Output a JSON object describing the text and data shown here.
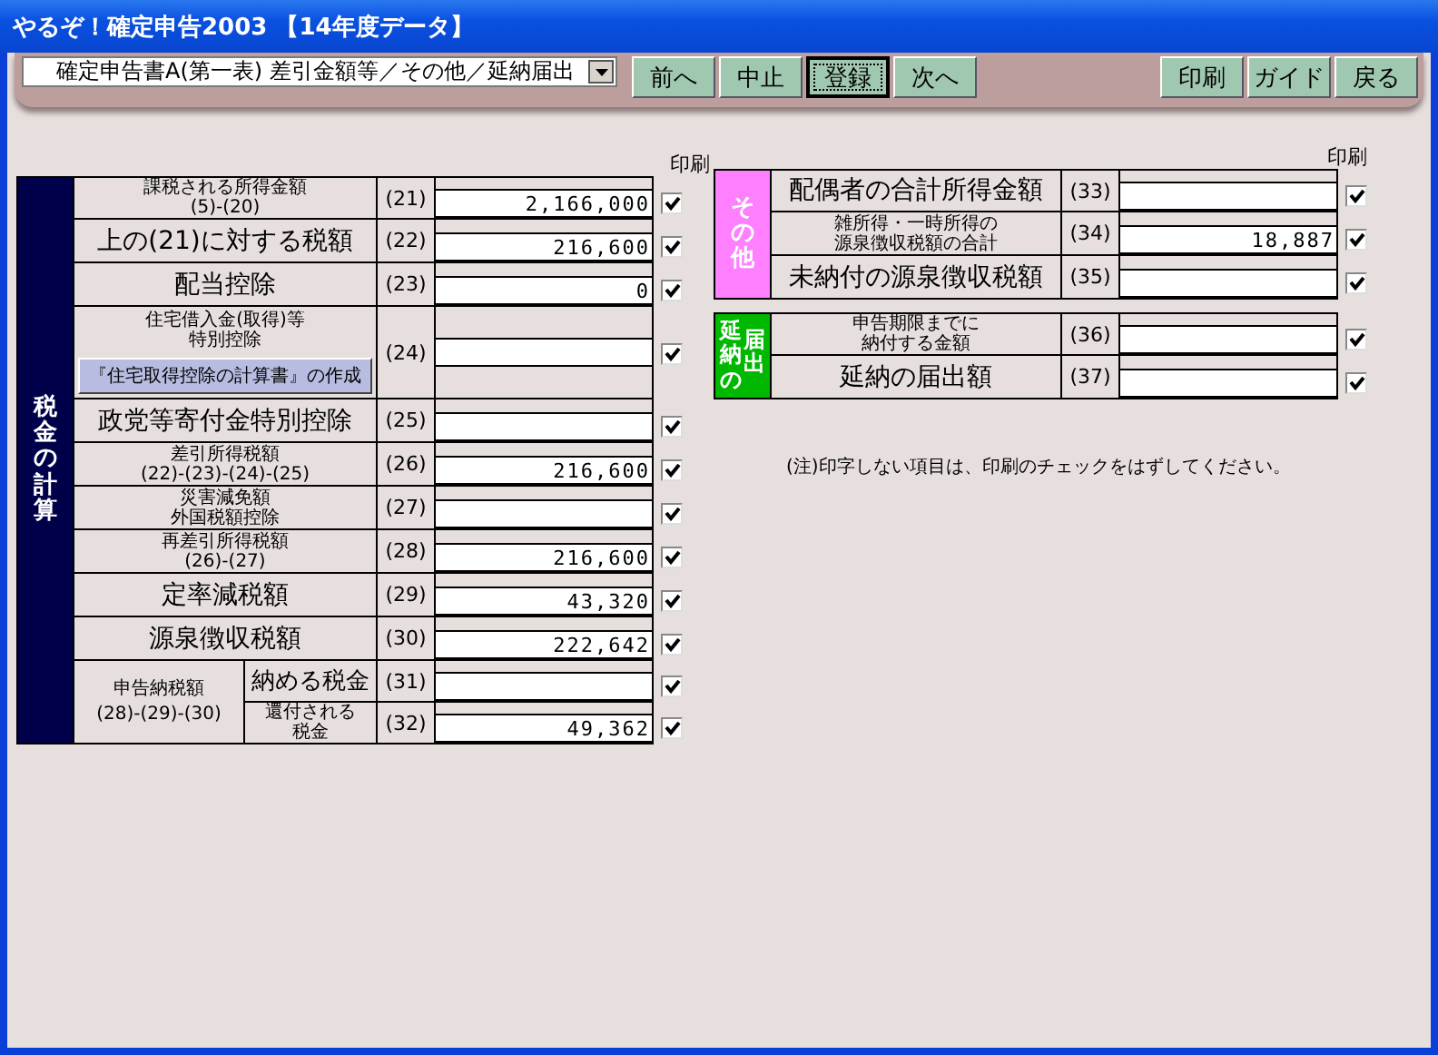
{
  "window": {
    "title": "やるぞ！確定申告2003 【14年度データ】"
  },
  "toolbar": {
    "form_select": {
      "value": "確定申告書A(第一表) 差引金額等／その他／延納届出"
    },
    "nav_buttons": [
      {
        "label": "前へ",
        "focused": false
      },
      {
        "label": "中止",
        "focused": false
      },
      {
        "label": "登録",
        "focused": true
      },
      {
        "label": "次へ",
        "focused": false
      }
    ],
    "right_buttons": [
      {
        "label": "印刷",
        "focused": false
      },
      {
        "label": "ガイド",
        "focused": false
      },
      {
        "label": "戻る",
        "focused": false
      }
    ]
  },
  "tax_section": {
    "title": "税金の計算",
    "print_header": "印刷",
    "rows": [
      {
        "kind": "field",
        "lines": [
          "課税される所得金額",
          "(5)-(20)"
        ],
        "number": "(21)",
        "value": "2,166,000",
        "checked": true
      },
      {
        "kind": "field",
        "lines": [
          "上の(21)に対する税額"
        ],
        "number": "(22)",
        "value": "216,600",
        "checked": true
      },
      {
        "kind": "field",
        "lines": [
          "配当控除"
        ],
        "number": "(23)",
        "value": "0",
        "checked": true
      },
      {
        "kind": "button",
        "lines": [
          "住宅借入金(取得)等",
          "特別控除"
        ],
        "button": "『住宅取得控除の計算書』の作成",
        "number": "(24)",
        "checked": true
      },
      {
        "kind": "field",
        "lines": [
          "政党等寄付金特別控除"
        ],
        "number": "(25)",
        "checked": true
      },
      {
        "kind": "field",
        "lines": [
          "差引所得税額",
          "(22)-(23)-(24)-(25)"
        ],
        "number": "(26)",
        "value": "216,600",
        "checked": true
      },
      {
        "kind": "field",
        "lines": [
          "災害減免額",
          "外国税額控除"
        ],
        "number": "(27)",
        "checked": true
      },
      {
        "kind": "field",
        "lines": [
          "再差引所得税額",
          "(26)-(27)"
        ],
        "number": "(28)",
        "value": "216,600",
        "checked": true
      },
      {
        "kind": "field",
        "lines": [
          "定率減税額"
        ],
        "number": "(29)",
        "value": "43,320",
        "checked": true
      },
      {
        "kind": "field",
        "lines": [
          "源泉徴収税額"
        ],
        "number": "(30)",
        "value": "222,642",
        "checked": true
      },
      {
        "kind": "group",
        "lines": [
          "申告納税額",
          "(28)-(29)-(30)"
        ],
        "children": [
          {
            "lines": [
              "納める税金"
            ],
            "number": "(31)",
            "checked": true
          },
          {
            "lines": [
              "還付される",
              "税金"
            ],
            "number": "(32)",
            "value": "49,362",
            "checked": true
          }
        ]
      }
    ]
  },
  "other_section": {
    "title": "その他",
    "print_header": "印刷",
    "rows": [
      {
        "kind": "field",
        "lines": [
          "配偶者の合計所得金額"
        ],
        "number": "(33)",
        "checked": true
      },
      {
        "kind": "field",
        "lines": [
          "雑所得・一時所得の",
          "源泉徴収税額の合計"
        ],
        "number": "(34)",
        "value": "18,887",
        "checked": true
      },
      {
        "kind": "field",
        "lines": [
          "未納付の源泉徴収税額"
        ],
        "number": "(35)",
        "checked": true
      }
    ]
  },
  "deferral_section": {
    "title_columns": [
      "延納の",
      "届出"
    ],
    "rows": [
      {
        "kind": "field",
        "lines": [
          "申告期限までに",
          "納付する金額"
        ],
        "number": "(36)",
        "checked": true
      },
      {
        "kind": "field",
        "lines": [
          "延納の届出額"
        ],
        "number": "(37)",
        "checked": true
      }
    ]
  },
  "note": "(注)印字しない項目は、印刷のチェックをはずしてください。"
}
